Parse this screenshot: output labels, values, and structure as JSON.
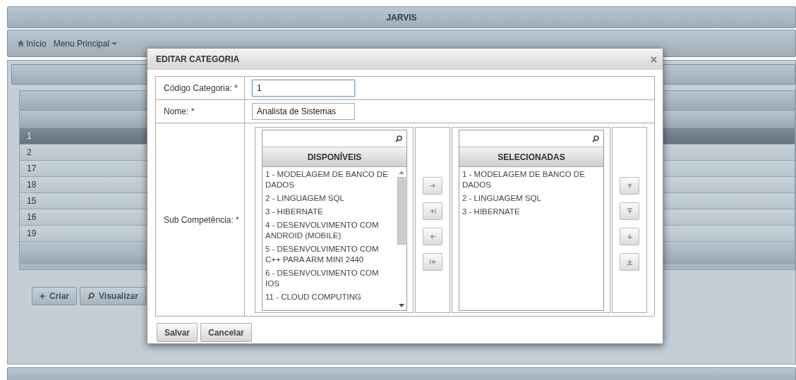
{
  "app_title": "JARVIS",
  "menu": [
    {
      "label": "Início",
      "kind": "home"
    },
    {
      "label": "Menu Principal",
      "kind": "dropdown"
    }
  ],
  "table": {
    "rows": [
      {
        "cell": "1",
        "selected": true
      },
      {
        "cell": "2",
        "selected": false
      },
      {
        "cell": "17",
        "selected": false
      },
      {
        "cell": "18",
        "selected": false
      },
      {
        "cell": "15",
        "selected": false
      },
      {
        "cell": "16",
        "selected": false
      },
      {
        "cell": "19",
        "selected": false
      }
    ]
  },
  "page_buttons": [
    {
      "label": "Criar",
      "kind": "plus"
    },
    {
      "label": "Visualizar",
      "kind": "search"
    }
  ],
  "dialog": {
    "title": "EDITAR CATEGORIA",
    "fields": [
      {
        "label": "Código Categoria: *",
        "value": "1",
        "focused": true
      },
      {
        "label": "Nome: *",
        "value": "Analista de Sistemas",
        "focused": false
      }
    ],
    "picklist_label": "Sub Competência: *",
    "source": {
      "header": "DISPONÍVEIS",
      "items": [
        "1 - MODELAGEM DE BANCO DE DADOS",
        "2 - LINGUAGEM SQL",
        "3 - HIBERNATE",
        "4 - DESENVOLVIMENTO COM ANDROID (MOBILE)",
        "5 - DESENVOLVIMENTO COM C++ PARA ARM MINI 2440",
        "6 - DESENVOLVIMENTO COM IOS",
        "11 - CLOUD COMPUTING"
      ]
    },
    "transfer_buttons": [
      {
        "kind": "right"
      },
      {
        "kind": "right-all"
      },
      {
        "kind": "left"
      },
      {
        "kind": "left-all"
      }
    ],
    "target": {
      "header": "SELECIONADAS",
      "items": [
        "1 - MODELAGEM DE BANCO DE DADOS",
        "2 - LINGUAGEM SQL",
        "3 - HIBERNATE"
      ]
    },
    "order_buttons": [
      {
        "kind": "up"
      },
      {
        "kind": "top"
      },
      {
        "kind": "down"
      },
      {
        "kind": "bottom"
      }
    ],
    "buttons": [
      "Salvar",
      "Cancelar"
    ]
  }
}
